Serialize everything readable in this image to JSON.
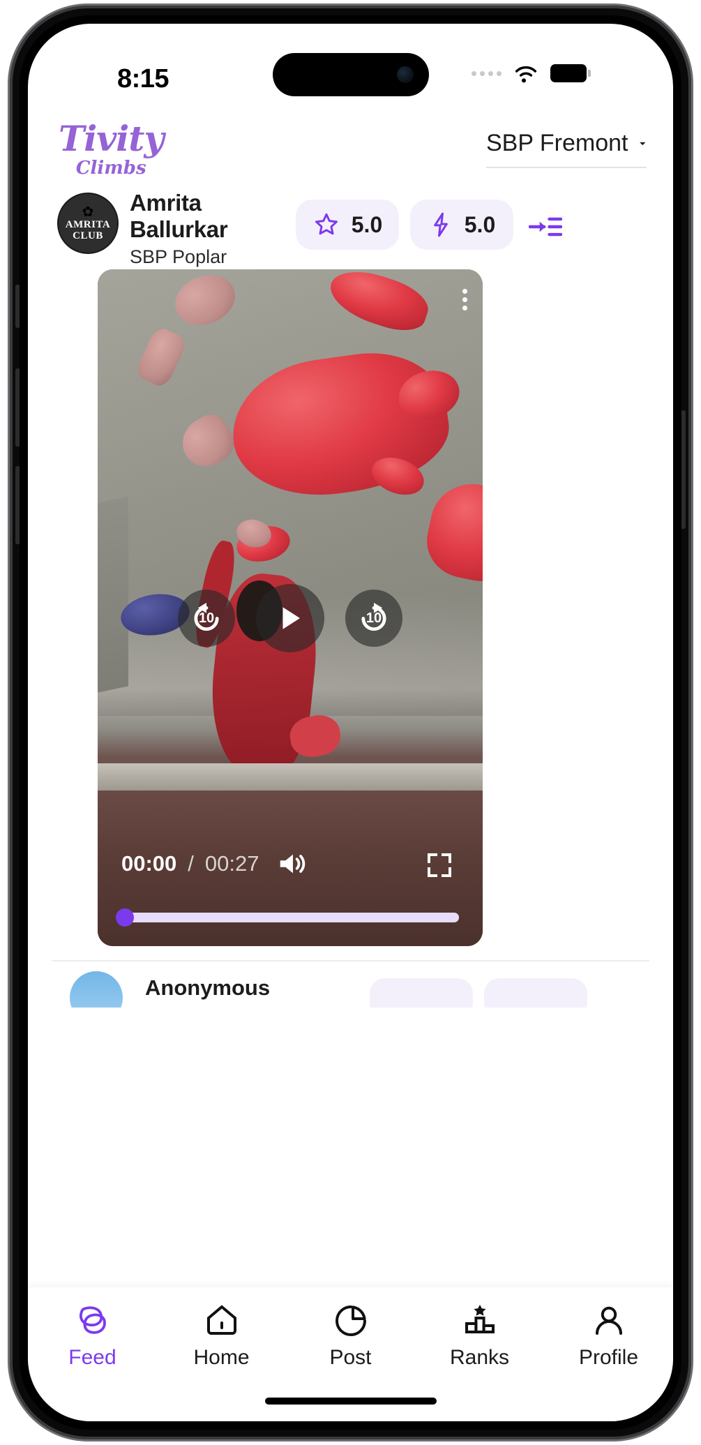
{
  "status_bar": {
    "time": "8:15",
    "signal_icon": "signal-dots-icon",
    "wifi_icon": "wifi-icon",
    "battery_icon": "battery-full-icon"
  },
  "header": {
    "brand_main": "Tivity",
    "brand_sub": "Climbs",
    "gym_selector_value": "SBP Fremont",
    "gym_selector_icon": "chevron-down-icon",
    "brand_color": "#9563d6"
  },
  "post": {
    "avatar_flame": "✿",
    "avatar_line1": "AMRITA",
    "avatar_line2": "CLUB",
    "user_name": "Amrita Ballurkar",
    "user_gym": "SBP Poplar",
    "rating_icon": "star-icon",
    "rating_value": "5.0",
    "power_icon": "lightning-bolt-icon",
    "power_value": "5.0",
    "list_action_icon": "add-to-list-icon",
    "accent_color": "#7c3aed",
    "pill_background": "#f4f0fb"
  },
  "video": {
    "menu_icon": "more-vertical-icon",
    "rewind_icon": "rewind-10-icon",
    "rewind_seconds": "10",
    "play_icon": "play-icon",
    "forward_icon": "forward-10-icon",
    "forward_seconds": "10",
    "current_time": "00:00",
    "time_separator": "/",
    "total_time": "00:27",
    "volume_icon": "volume-up-icon",
    "fullscreen_icon": "fullscreen-icon",
    "progress_percent": 1
  },
  "next_post": {
    "user_name": "Anonymous"
  },
  "bottom_nav": {
    "items": [
      {
        "label": "Feed",
        "icon": "feed-icon",
        "active": true
      },
      {
        "label": "Home",
        "icon": "home-icon",
        "active": false
      },
      {
        "label": "Post",
        "icon": "post-icon",
        "active": false
      },
      {
        "label": "Ranks",
        "icon": "ranks-icon",
        "active": false
      },
      {
        "label": "Profile",
        "icon": "profile-icon",
        "active": false
      }
    ]
  }
}
